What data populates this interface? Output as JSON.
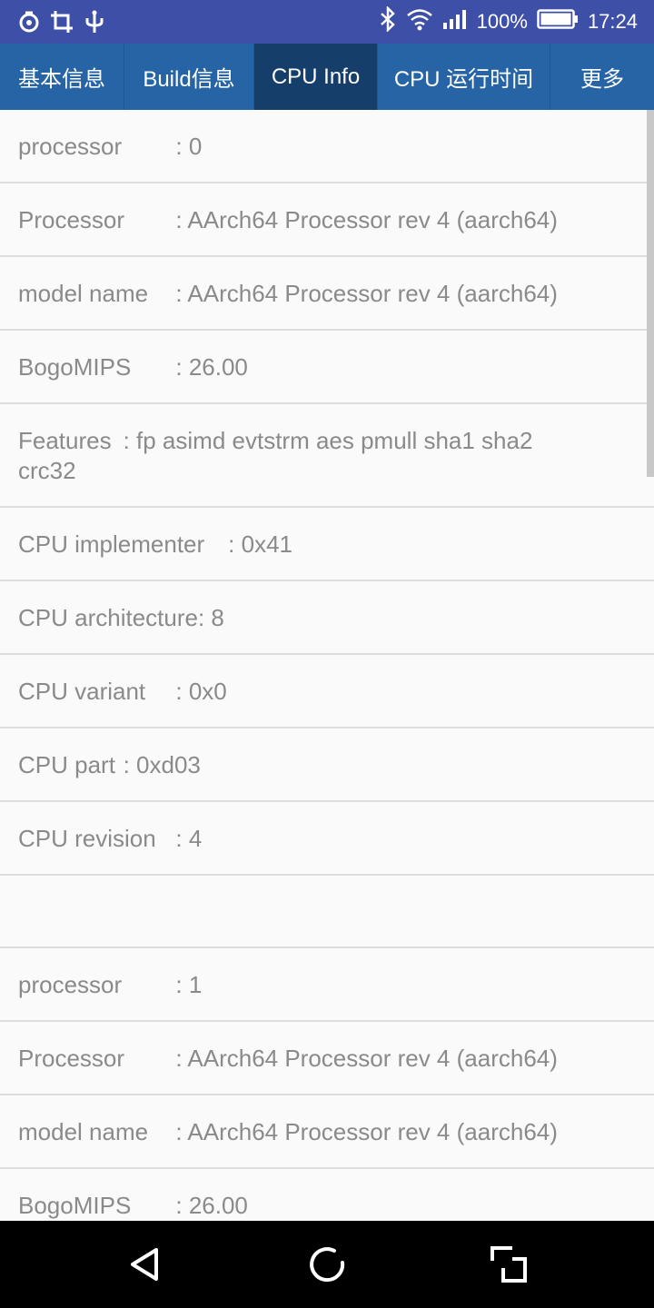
{
  "status_bar": {
    "battery": "100%",
    "time": "17:24",
    "left_icons": [
      "netease-icon",
      "crop-icon",
      "usb-icon"
    ],
    "right_icons": [
      "bluetooth-icon",
      "wifi-icon",
      "signal-icon",
      "battery-icon"
    ]
  },
  "tabs": [
    {
      "label": "基本信息",
      "active": false
    },
    {
      "label": "Build信息",
      "active": false
    },
    {
      "label": "CPU Info",
      "active": true
    },
    {
      "label": "CPU 运行时间",
      "active": false
    },
    {
      "label": "更多",
      "active": false
    }
  ],
  "rows": [
    "processor\t: 0",
    "Processor\t: AArch64 Processor rev 4 (aarch64)",
    "model name\t: AArch64 Processor rev 4 (aarch64)",
    "BogoMIPS\t: 26.00",
    "Features\t: fp asimd evtstrm aes pmull sha1 sha2 crc32",
    "CPU implementer\t: 0x41",
    "CPU architecture: 8",
    "CPU variant\t: 0x0",
    "CPU part\t: 0xd03",
    "CPU revision\t: 4",
    "",
    "processor\t: 1",
    "Processor\t: AArch64 Processor rev 4 (aarch64)",
    "model name\t: AArch64 Processor rev 4 (aarch64)",
    "BogoMIPS\t: 26.00"
  ],
  "nav_bar": {
    "icons": [
      "back-icon",
      "home-icon",
      "recents-icon"
    ]
  }
}
